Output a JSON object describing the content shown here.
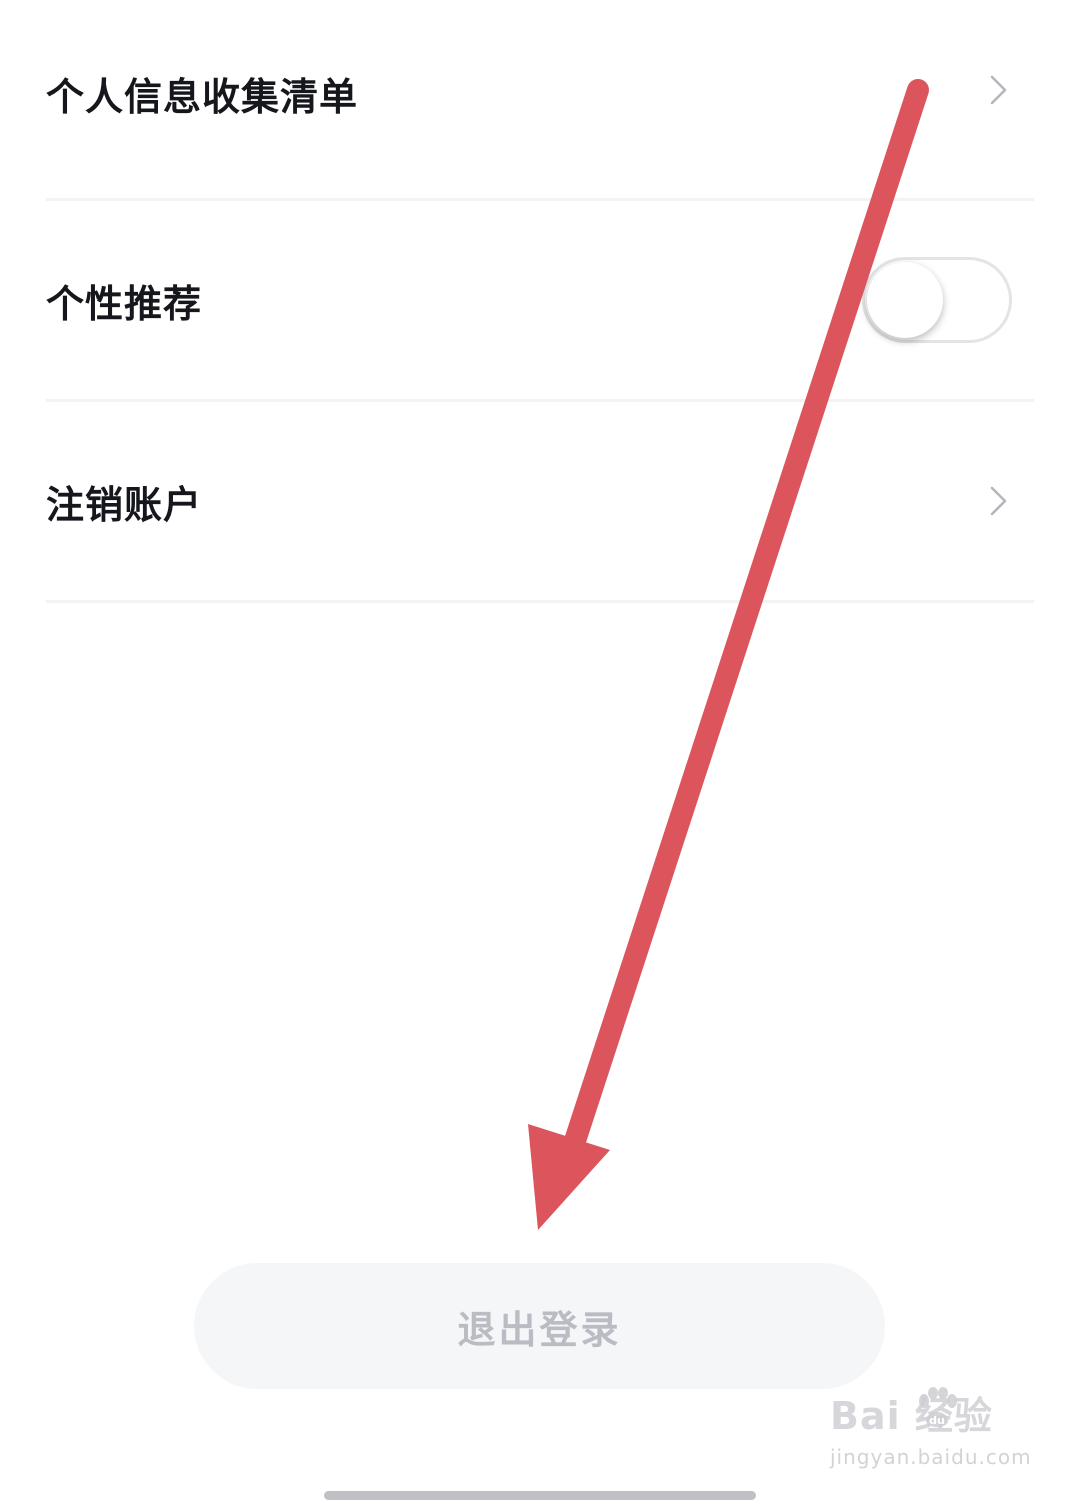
{
  "settings": {
    "items": [
      {
        "label": "个人信息收集清单",
        "control": "chevron-right-icon"
      },
      {
        "label": "个性推荐",
        "control": "toggle",
        "toggle_on": false
      },
      {
        "label": "注销账户",
        "control": "chevron-right-icon"
      }
    ]
  },
  "logout": {
    "label": "退出登录"
  },
  "annotation": {
    "icon": "red-arrow-icon",
    "color": "#dc555c"
  },
  "watermark": {
    "brand": "Bai  经验",
    "url": "jingyan.baidu.com"
  },
  "colors": {
    "text_primary": "#15171c",
    "divider": "#f2f3f5",
    "button_bg": "#f5f6f8",
    "button_text": "#b9bcc2",
    "chevron": "#b5b7bc"
  }
}
